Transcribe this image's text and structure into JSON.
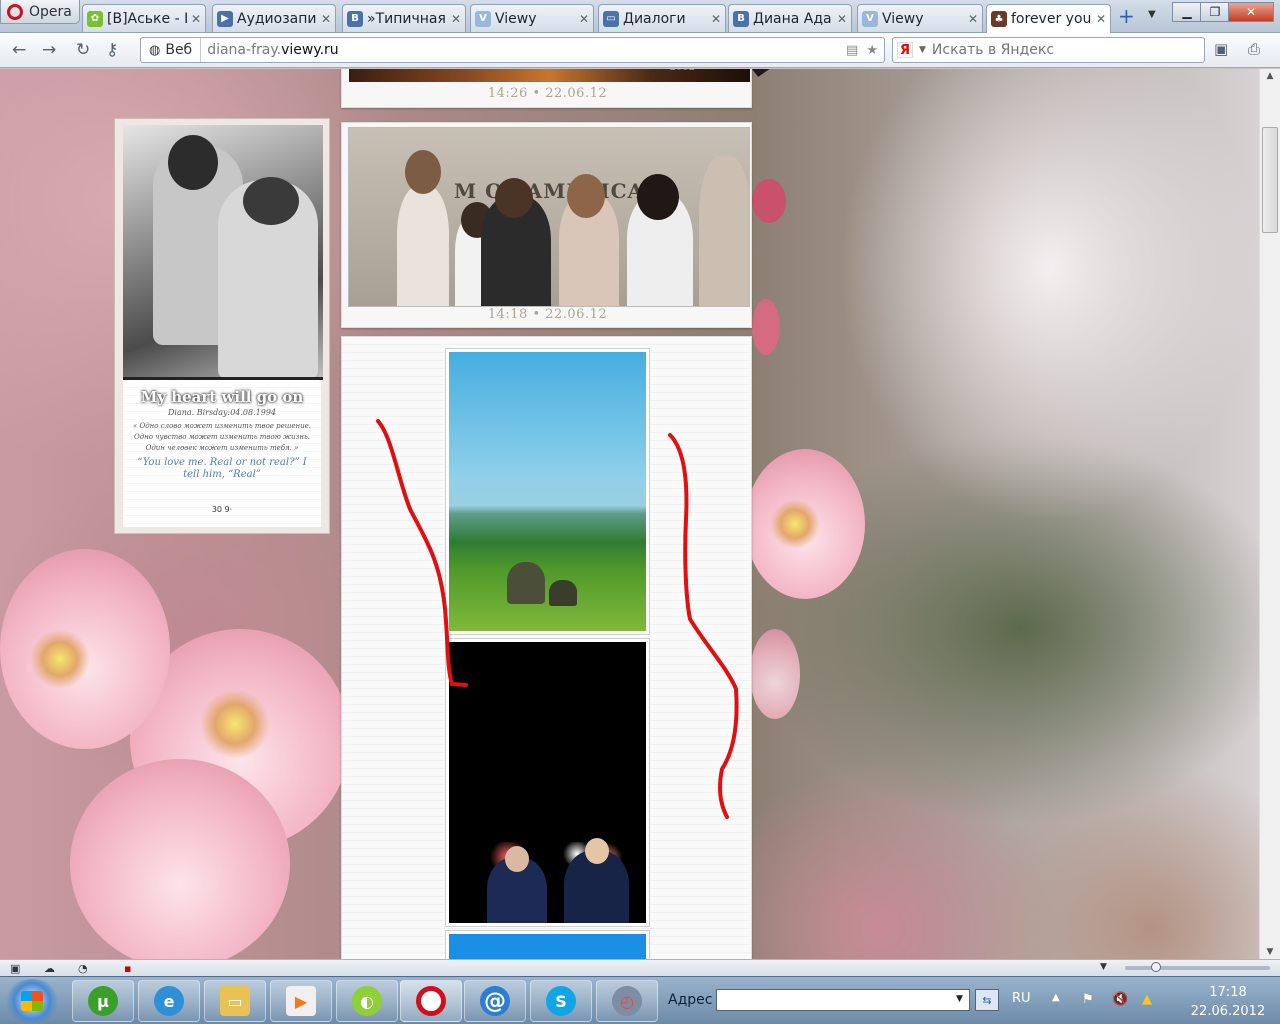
{
  "browser": {
    "menu_label": "Opera",
    "tabs": [
      {
        "title": "[B]Аське - I...",
        "fav_color": "#7bbf2e",
        "fav_char": "✿"
      },
      {
        "title": "Аудиозапи...",
        "fav_color": "#4b72a6",
        "fav_char": "▶"
      },
      {
        "title": "»Типичная...",
        "fav_color": "#4b72a6",
        "fav_char": "B"
      },
      {
        "title": "Viewy",
        "fav_color": "#9ab6d8",
        "fav_char": "V"
      },
      {
        "title": "Диалоги",
        "fav_color": "#4b72a6",
        "fav_char": "▭"
      },
      {
        "title": "Диана Ада...",
        "fav_color": "#4b72a6",
        "fav_char": "B"
      },
      {
        "title": "Viewy",
        "fav_color": "#9ab6d8",
        "fav_char": "V"
      },
      {
        "title": "forever you...",
        "fav_color": "#6b3b2a",
        "fav_char": "♣"
      }
    ],
    "address": {
      "mode_label": "Веб",
      "url_prefix": "diana-fray.",
      "url_domain": "viewy.ru"
    },
    "search": {
      "placeholder": "Искать в Яндекс",
      "engine_char": "Я"
    }
  },
  "page": {
    "profile": {
      "name": "My heart will go on",
      "birthday": "Diana. Birsday:04.08.1994",
      "quote_lines": [
        "« Одно слово может изменить твое решение.",
        "Одно чувство может изменить твою жизнь.",
        "Один человек может изменить тебя. »"
      ],
      "quote2": "“You love me. Real or not real?” I tell him, “Real”",
      "count": "30 9·"
    },
    "posts": [
      {
        "timestamp": "14:26  •  22.06.12",
        "year_label": "2012"
      },
      {
        "timestamp": "14:18  •  22.06.12",
        "sign_text": "M  OF AMERICA"
      }
    ]
  },
  "taskbar": {
    "address_label": "Адрес",
    "address_value": "",
    "language": "RU",
    "time": "17:18",
    "date": "22.06.2012"
  }
}
